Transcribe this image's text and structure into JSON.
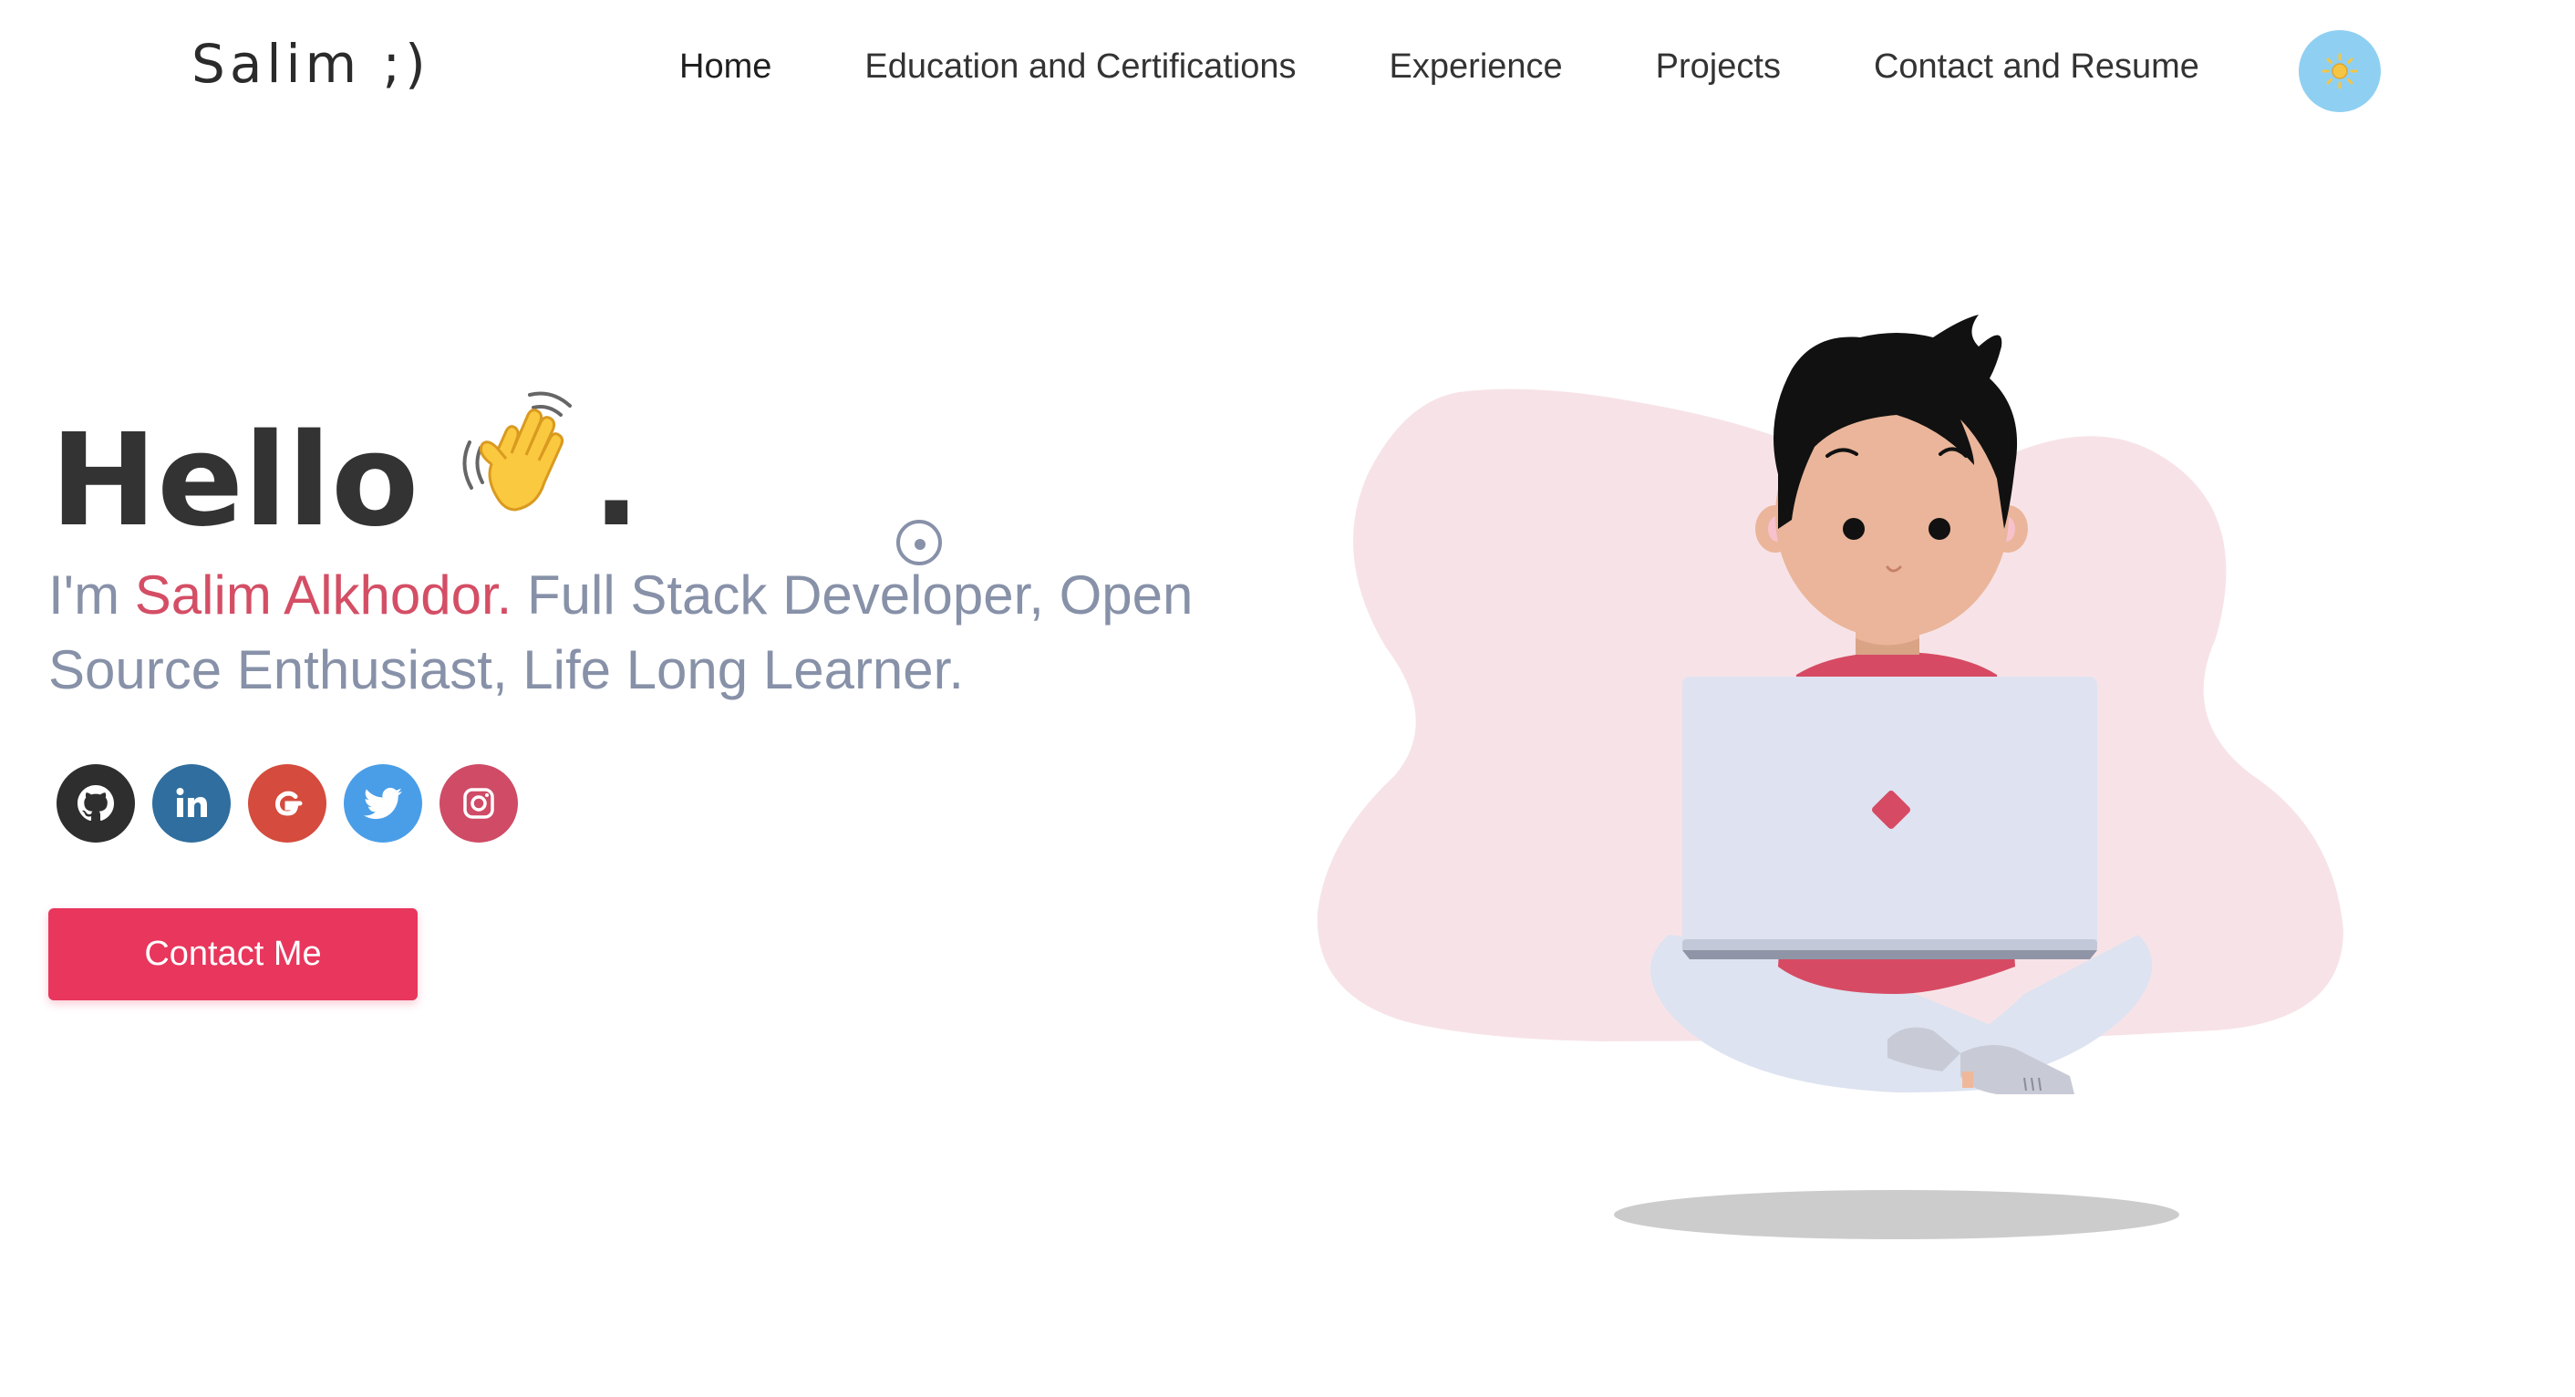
{
  "header": {
    "logo": "Salim ;)",
    "nav": [
      {
        "label": "Home"
      },
      {
        "label": "Education and Certifications"
      },
      {
        "label": "Experience"
      },
      {
        "label": "Projects"
      },
      {
        "label": "Contact and Resume"
      }
    ],
    "theme_toggle_icon": "sun-icon"
  },
  "hero": {
    "greeting": "Hello",
    "greeting_emoji": "👋",
    "greeting_punct": ".",
    "intro_prefix": "I'm ",
    "name": "Salim Alkhodor.",
    "intro_rest": " Full Stack Developer, Open Source Enthusiast, Life Long Learner.",
    "socials": [
      {
        "icon": "github-icon",
        "color": "#2e2e2e"
      },
      {
        "icon": "linkedin-icon",
        "color": "#2f6e9e"
      },
      {
        "icon": "google-icon",
        "color": "#d54b3d"
      },
      {
        "icon": "twitter-icon",
        "color": "#4a9ee8"
      },
      {
        "icon": "instagram-icon",
        "color": "#cf4b66"
      }
    ],
    "cta_label": "Contact Me"
  },
  "colors": {
    "accent": "#e8365d",
    "name_highlight": "#d44e65",
    "subtitle_text": "#8791a8",
    "blob": "#f7e3e7",
    "toggle_bg": "#8fd0f2"
  }
}
